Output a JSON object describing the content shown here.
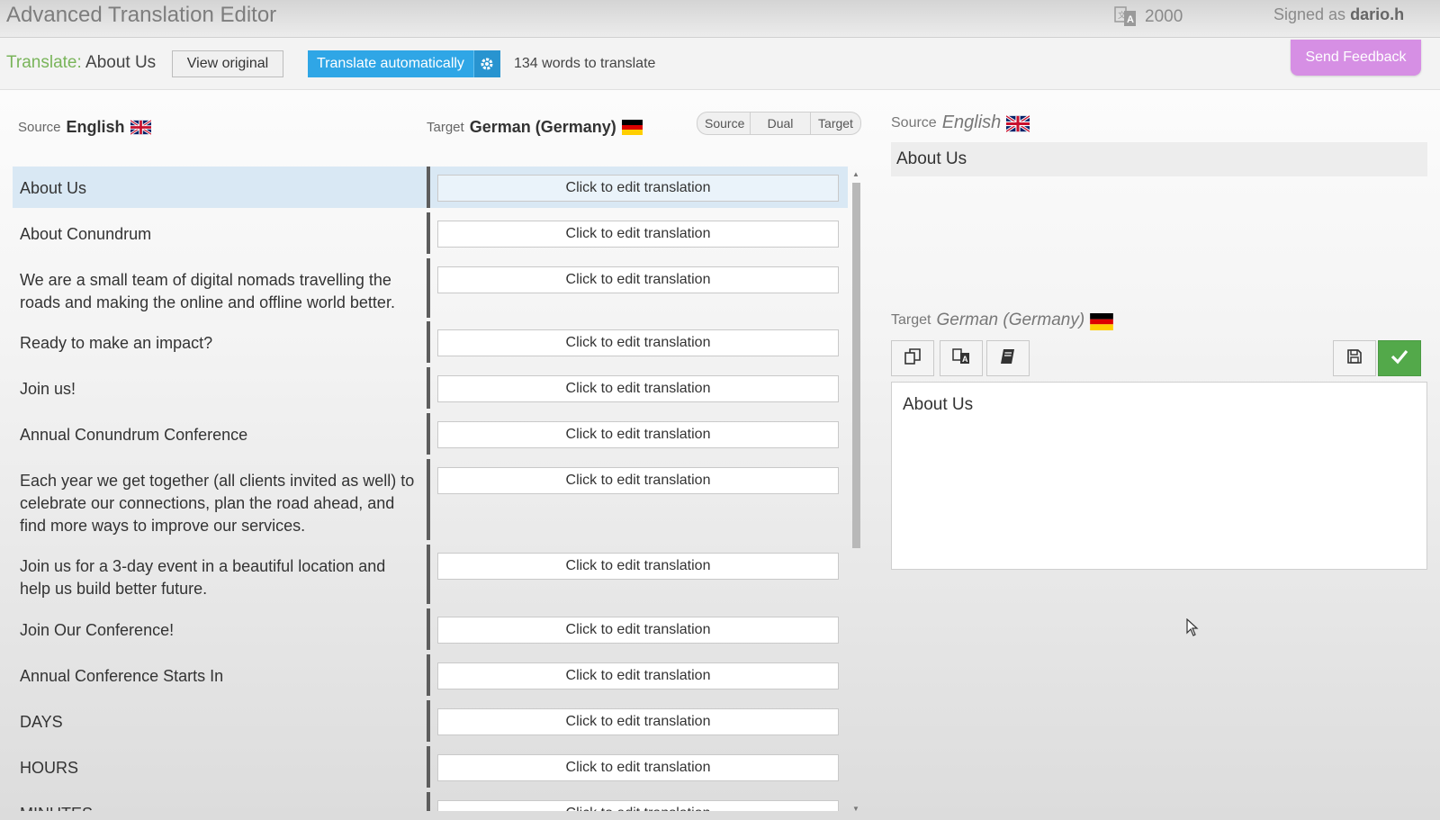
{
  "header": {
    "app_title": "Advanced Translation Editor",
    "credits": "2000",
    "signed_prefix": "Signed as",
    "username": "dario.h"
  },
  "toolbar": {
    "translate_keyword": "Translate:",
    "page_name": "About Us",
    "view_original_label": "View original",
    "translate_auto_label": "Translate automatically",
    "words_count": "134 words to translate",
    "feedback_label": "Send Feedback"
  },
  "languages": {
    "source_label": "Source",
    "source_name": "English",
    "target_label": "Target",
    "target_name": "German (Germany)"
  },
  "view_modes": [
    "Source",
    "Dual",
    "Target"
  ],
  "edit_placeholder": "Click to edit translation",
  "rows": [
    {
      "source": "About Us"
    },
    {
      "source": "About Conundrum"
    },
    {
      "source": "We are a small team of digital nomads travelling the roads and making the online and offline world better."
    },
    {
      "source": "Ready to make an impact?"
    },
    {
      "source": "Join us!"
    },
    {
      "source": "Annual Conundrum Conference"
    },
    {
      "source": "Each year we get together (all clients invited as well) to celebrate our connections, plan the road ahead, and find more ways to improve our services."
    },
    {
      "source": "Join us for a 3-day event in a beautiful location and help us build better future."
    },
    {
      "source": "Join Our Conference!"
    },
    {
      "source": "Annual Conference Starts In"
    },
    {
      "source": "DAYS"
    },
    {
      "source": "HOURS"
    },
    {
      "source": "MINUTES"
    }
  ],
  "editor": {
    "source_preview": "About Us",
    "target_text": "About Us"
  },
  "colors": {
    "accent_blue": "#2fa6e6",
    "feedback_purple": "#d68fe4",
    "confirm_green": "#53a94a",
    "active_row": "#d9e8f4"
  }
}
